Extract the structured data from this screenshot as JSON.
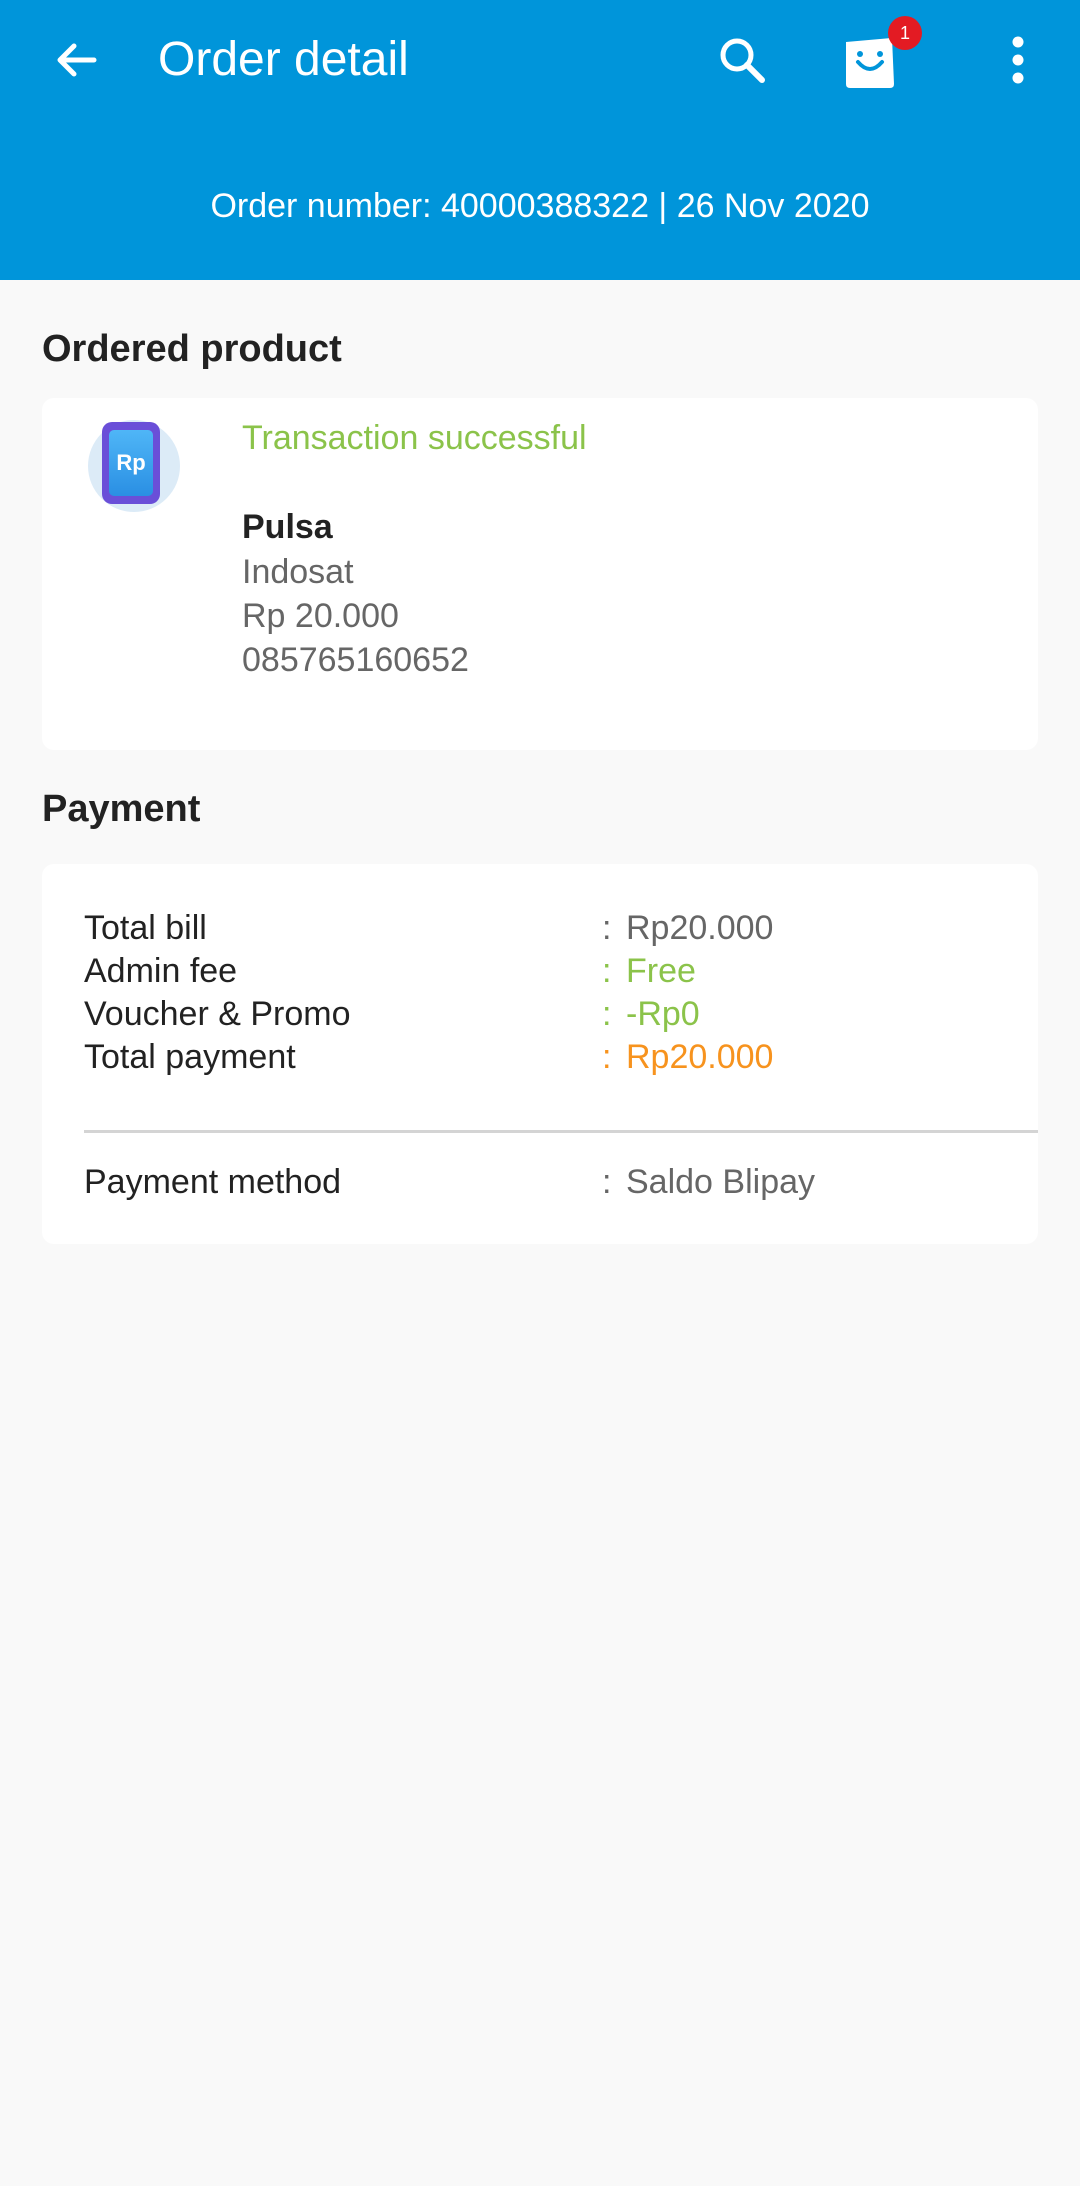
{
  "header": {
    "title": "Order detail",
    "cart_count": "1",
    "order_line": "Order number: 40000388322 | 26 Nov 2020",
    "brand_color": "#0095DA"
  },
  "icons": {
    "back": "arrow-back-icon",
    "search": "search-icon",
    "cart": "shopping-bag-icon",
    "more": "more-vertical-icon",
    "product": "phone-credit-icon",
    "product_icon_text": "Rp"
  },
  "ordered_product": {
    "heading": "Ordered product",
    "status": "Transaction successful",
    "name": "Pulsa",
    "operator": "Indosat",
    "nominal": "Rp 20.000",
    "phone_number": "085765160652"
  },
  "payment": {
    "heading": "Payment",
    "rows": [
      {
        "label": "Total bill",
        "colon": ":",
        "value": "Rp20.000"
      },
      {
        "label": "Admin fee",
        "colon": ":",
        "value": "Free"
      },
      {
        "label": "Voucher & Promo",
        "colon": ":",
        "value": "-Rp0"
      },
      {
        "label": "Total payment",
        "colon": ":",
        "value": "Rp20.000"
      }
    ],
    "method": {
      "label": "Payment method",
      "colon": ":",
      "value": "Saldo Blipay"
    }
  },
  "colors": {
    "success_green": "#8BC34A",
    "total_orange": "#F7931E",
    "badge_red": "#E31B23"
  }
}
